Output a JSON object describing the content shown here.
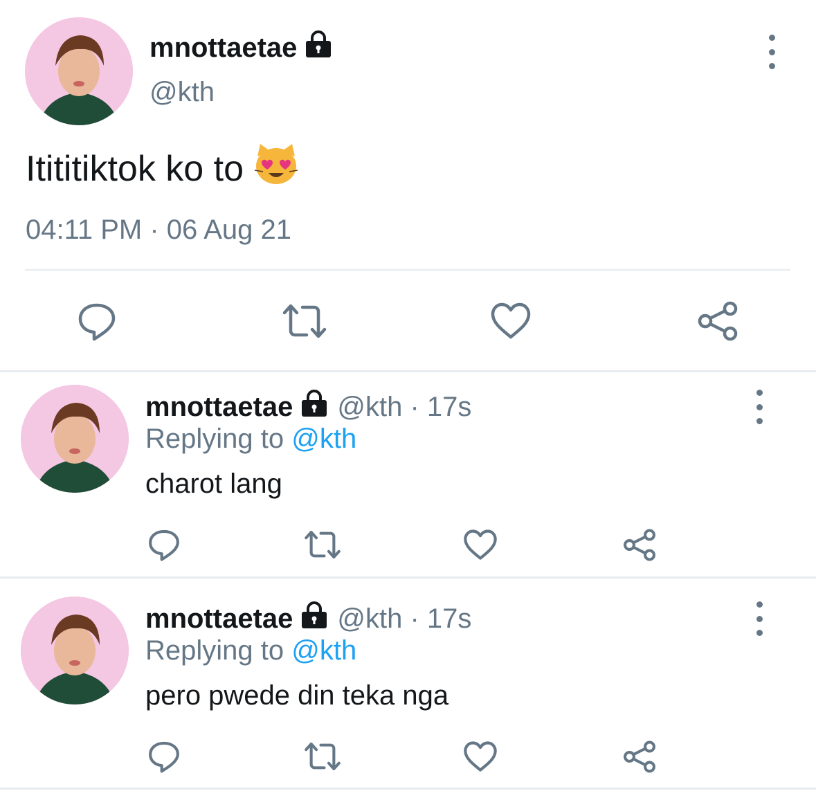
{
  "colors": {
    "primary_text": "#14171a",
    "secondary_text": "#657786",
    "link": "#1da1f2",
    "divider": "#e6ecf0",
    "avatar_bg": "#f4c7e3"
  },
  "main_tweet": {
    "display_name": "mnottaetae",
    "handle": "@kth",
    "text": "Itititiktok ko to",
    "emoji": "smiling-cat-heart-eyes",
    "timestamp": "04:11 PM · 06 Aug 21",
    "icons": [
      "more-vertical-icon",
      "lock-icon",
      "reply-icon",
      "retweet-icon",
      "like-icon",
      "share-icon"
    ]
  },
  "replies": [
    {
      "display_name": "mnottaetae",
      "meta": "@kth · 17s",
      "replying_label": "Replying to ",
      "replying_to": "@kth",
      "text": "charot lang"
    },
    {
      "display_name": "mnottaetae",
      "meta": "@kth · 17s",
      "replying_label": "Replying to ",
      "replying_to": "@kth",
      "text": "pero pwede din teka nga"
    }
  ]
}
